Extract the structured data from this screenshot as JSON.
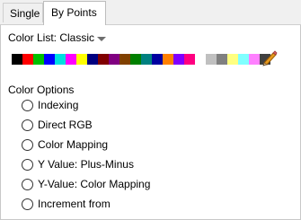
{
  "tabs": [
    {
      "label": "Single"
    },
    {
      "label": "By Points"
    }
  ],
  "color_list": {
    "label": "Color List: Classic",
    "swatches": [
      "#000000",
      "#ff0000",
      "#00c000",
      "#0000ff",
      "#00e0e0",
      "#ff00ff",
      "#ffff00",
      "#000080",
      "#800000",
      "#800080",
      "#804000",
      "#008000",
      "#008080",
      "#0000a0",
      "#ff8000",
      "#8000ff",
      "#ff0080",
      "#ffffff",
      "#c0c0c0",
      "#808080",
      "#ffff80",
      "#80ffff",
      "#ff80ff",
      "#404040"
    ],
    "edit_icon": "pencil-icon"
  },
  "color_options": {
    "title": "Color Options",
    "options": [
      {
        "label": "Indexing"
      },
      {
        "label": "Direct RGB"
      },
      {
        "label": "Color Mapping"
      },
      {
        "label": "Y Value: Plus-Minus"
      },
      {
        "label": "Y-Value: Color Mapping"
      },
      {
        "label": "Increment from"
      }
    ]
  }
}
